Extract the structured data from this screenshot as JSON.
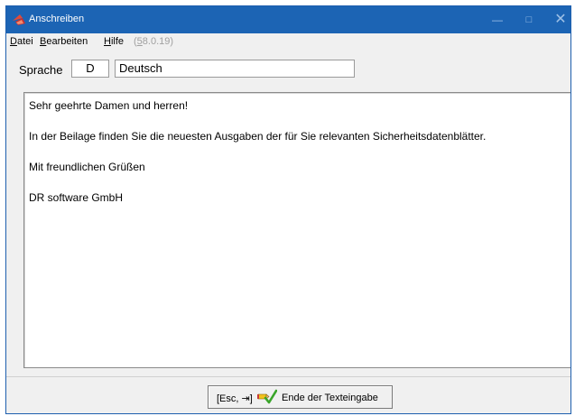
{
  "window": {
    "title": "Anschreiben",
    "controls": {
      "minimize": "—",
      "maximize": "□",
      "close": "✕"
    }
  },
  "menu": {
    "items": [
      {
        "accel": "D",
        "rest": "atei"
      },
      {
        "accel": "B",
        "rest": "earbeiten"
      },
      {
        "accel": "H",
        "rest": "ilfe"
      }
    ],
    "version": {
      "open": "(",
      "accel": "5",
      "rest": "8.0.19)"
    }
  },
  "language": {
    "label": "Sprache",
    "code": "D",
    "name": "Deutsch"
  },
  "letter": {
    "lines": [
      "Sehr geehrte Damen und herren!",
      "In der Beilage finden Sie die neuesten Ausgaben der für Sie relevanten Sicherheitsdatenblätter.",
      "Mit freundlichen Grüßen",
      "DR software GmbH"
    ]
  },
  "footer": {
    "button_key": "[Esc, ⇥]",
    "button_icon": "pencil-check-icon",
    "button_label": "Ende der Texteingabe"
  },
  "colors": {
    "titlebar": "#1c64b4",
    "window_bg": "#f0f0f0",
    "check_green": "#3aa52a",
    "pencil_yellow": "#f3c21b"
  }
}
